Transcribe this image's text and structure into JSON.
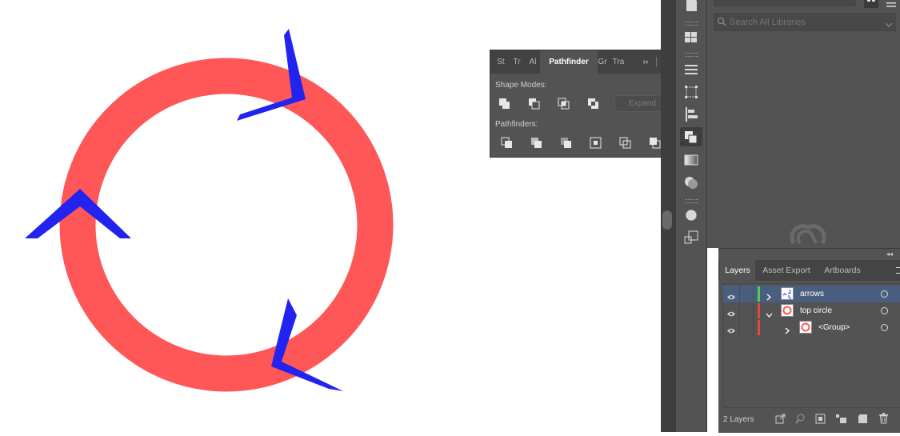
{
  "colors": {
    "ring": "#ff5757",
    "arrow": "#2323ef",
    "panel": "#535353",
    "dark": "#424242",
    "selection": "#4a5f7f"
  },
  "pathfinder": {
    "tabs": [
      {
        "label": "St",
        "active": false
      },
      {
        "label": "Tr",
        "active": false
      },
      {
        "label": "Al",
        "active": false
      },
      {
        "label": "Pathfinder",
        "active": true
      },
      {
        "label": "Gr",
        "active": false
      },
      {
        "label": "Tra",
        "active": false
      }
    ],
    "overflow": "››",
    "shape_modes_label": "Shape Modes:",
    "pathfinders_label": "Pathfinders:",
    "expand_label": "Expand",
    "shape_mode_icons": [
      "unite-icon",
      "minus-front-icon",
      "intersect-icon",
      "exclude-icon"
    ],
    "pathfinder_icons": [
      "divide-icon",
      "trim-icon",
      "merge-icon",
      "crop-icon",
      "outline-icon",
      "minus-back-icon"
    ]
  },
  "libraries": {
    "search_placeholder": "Search All Libraries"
  },
  "layers": {
    "tabs": [
      {
        "label": "Layers",
        "active": true
      },
      {
        "label": "Asset Export",
        "active": false
      },
      {
        "label": "Artboards",
        "active": false
      }
    ],
    "rows": [
      {
        "name": "arrows",
        "color": "#4fd04f",
        "expanded": false,
        "selected": true,
        "indent": 0
      },
      {
        "name": "top circle",
        "color": "#e04848",
        "expanded": true,
        "selected": false,
        "indent": 0
      },
      {
        "name": "<Group>",
        "color": "#e04848",
        "expanded": false,
        "selected": false,
        "indent": 1
      }
    ],
    "count_label": "2 Layers"
  }
}
